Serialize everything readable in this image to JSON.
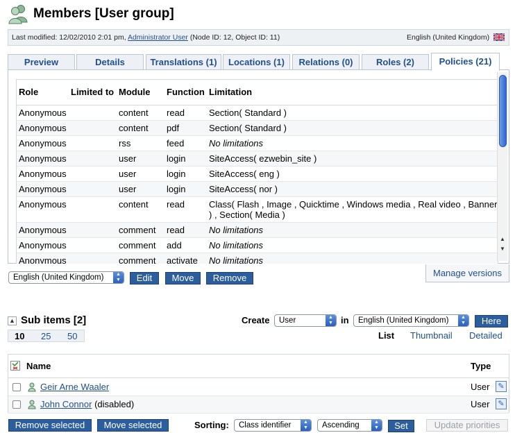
{
  "page": {
    "title": "Members [User group]",
    "icon": "user-group-icon"
  },
  "infobar": {
    "last_modified_prefix": "Last modified: 12/02/2010 2:01 pm,",
    "modifier": "Administrator User",
    "node_info": "(Node ID: 12, Object ID: 11)",
    "language": "English (United Kingdom)",
    "flag_icon": "uk-flag-icon"
  },
  "tabs": [
    {
      "label": "Preview"
    },
    {
      "label": "Details"
    },
    {
      "label": "Translations (1)"
    },
    {
      "label": "Locations (1)"
    },
    {
      "label": "Relations (0)"
    },
    {
      "label": "Roles (2)"
    },
    {
      "label": "Policies (21)",
      "active": true
    }
  ],
  "policies": {
    "columns": [
      "Role",
      "Limited to",
      "Module",
      "Function",
      "Limitation"
    ],
    "rows": [
      {
        "role": "Anonymous",
        "limited_to": "",
        "module": "content",
        "function": "read",
        "limitation": "Section( Standard )",
        "none": false
      },
      {
        "role": "Anonymous",
        "limited_to": "",
        "module": "content",
        "function": "pdf",
        "limitation": "Section( Standard )",
        "none": false
      },
      {
        "role": "Anonymous",
        "limited_to": "",
        "module": "rss",
        "function": "feed",
        "limitation": "No limitations",
        "none": true
      },
      {
        "role": "Anonymous",
        "limited_to": "",
        "module": "user",
        "function": "login",
        "limitation": "SiteAccess( ezwebin_site )",
        "none": false
      },
      {
        "role": "Anonymous",
        "limited_to": "",
        "module": "user",
        "function": "login",
        "limitation": "SiteAccess( eng )",
        "none": false
      },
      {
        "role": "Anonymous",
        "limited_to": "",
        "module": "user",
        "function": "login",
        "limitation": "SiteAccess( nor )",
        "none": false
      },
      {
        "role": "Anonymous",
        "limited_to": "",
        "module": "content",
        "function": "read",
        "limitation": "Class( Flash , Image , Quicktime , Windows media , Real video , Banner ) , Section( Media )",
        "none": false
      },
      {
        "role": "Anonymous",
        "limited_to": "",
        "module": "comment",
        "function": "read",
        "limitation": "No limitations",
        "none": true
      },
      {
        "role": "Anonymous",
        "limited_to": "",
        "module": "comment",
        "function": "add",
        "limitation": "No limitations",
        "none": true
      },
      {
        "role": "Anonymous",
        "limited_to": "",
        "module": "comment",
        "function": "activate",
        "limitation": "No limitations",
        "none": true
      }
    ]
  },
  "actions": {
    "language_select": "English (United Kingdom)",
    "edit": "Edit",
    "move": "Move",
    "remove": "Remove",
    "manage_versions": "Manage versions"
  },
  "subitems": {
    "title": "Sub items [2]",
    "collapse_icon": "collapse-icon",
    "create_label": "Create",
    "create_class": "User",
    "in_label": "in",
    "in_language": "English (United Kingdom)",
    "here": "Here",
    "limits": [
      {
        "label": "10",
        "active": true
      },
      {
        "label": "25",
        "active": false
      },
      {
        "label": "50",
        "active": false
      }
    ],
    "views": [
      {
        "label": "List",
        "active": true
      },
      {
        "label": "Thumbnail",
        "active": false
      },
      {
        "label": "Detailed",
        "active": false
      }
    ],
    "columns": {
      "name": "Name",
      "type": "Type"
    },
    "items": [
      {
        "name": "Geir Arne Waaler",
        "suffix": "",
        "type": "User"
      },
      {
        "name": "John Connor",
        "suffix": "(disabled)",
        "type": "User"
      }
    ],
    "remove_selected": "Remove selected",
    "move_selected": "Move selected",
    "sorting_label": "Sorting:",
    "sort_field": "Class identifier",
    "sort_order": "Ascending",
    "set": "Set",
    "update_priorities": "Update priorities"
  }
}
